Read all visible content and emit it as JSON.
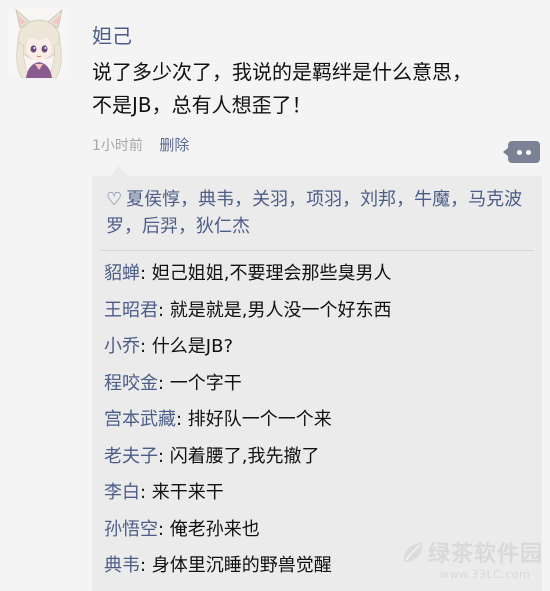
{
  "post": {
    "author": "妲己",
    "text_line1": "说了多少次了，我说的是羁绊是什么意思，",
    "text_line2": "不是JB，总有人想歪了！",
    "time": "1小时前",
    "delete_label": "删除"
  },
  "likes": {
    "icon": "heart-outline-icon",
    "names": "夏侯惇，典韦，关羽，项羽，刘邦，牛魔，马克波罗，后羿，狄仁杰"
  },
  "comments": [
    {
      "author": "貂蝉",
      "sep": ": ",
      "text": "妲己姐姐,不要理会那些臭男人"
    },
    {
      "author": "王昭君",
      "sep": ": ",
      "text": "就是就是,男人没一个好东西"
    },
    {
      "author": "小乔",
      "sep": ": ",
      "text": "什么是JB?"
    },
    {
      "author": "程咬金",
      "sep": ": ",
      "text": "一个字干"
    },
    {
      "author": "宫本武藏",
      "sep": ": ",
      "text": "排好队一个一个来"
    },
    {
      "author": "老夫子",
      "sep": ": ",
      "text": "闪着腰了,我先撤了"
    },
    {
      "author": "李白",
      "sep": ": ",
      "text": "来干来干"
    },
    {
      "author": "孙悟空",
      "sep": ": ",
      "text": "俺老孙来也"
    },
    {
      "author": "典韦",
      "sep": ": ",
      "text": "身体里沉睡的野兽觉醒"
    }
  ],
  "watermark": {
    "brand": "绿茶软件园",
    "url": "www.33LC.com"
  },
  "colors": {
    "name_blue": "#4c5d88",
    "background": "#f4f4f4",
    "comment_bg": "#ebebeb"
  }
}
